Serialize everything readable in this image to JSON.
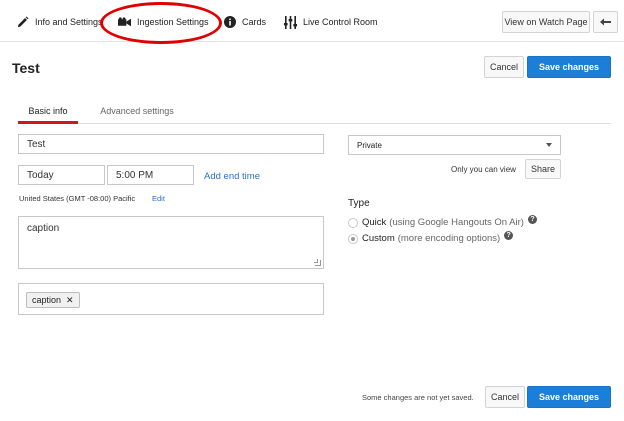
{
  "nav": {
    "items": [
      {
        "label": "Info and Settings",
        "icon": "pencil-icon"
      },
      {
        "label": "Ingestion Settings",
        "icon": "video-camera-icon"
      },
      {
        "label": "Cards",
        "icon": "info-icon"
      },
      {
        "label": "Live Control Room",
        "icon": "sliders-icon"
      }
    ],
    "view_on_watch_page": "View on Watch Page",
    "back_icon": "back-arrow-icon",
    "annotation_color": "#e00000"
  },
  "page": {
    "title": "Test",
    "cancel_label": "Cancel",
    "save_label": "Save changes"
  },
  "tabs": [
    {
      "label": "Basic info",
      "active": true
    },
    {
      "label": "Advanced settings",
      "active": false
    }
  ],
  "form": {
    "title_value": "Test",
    "date_value": "Today",
    "time_value": "5:00 PM",
    "add_end_time": "Add end time",
    "timezone": "United States (GMT -08:00) Pacific",
    "timezone_edit": "Edit",
    "description_value": "caption",
    "tags": [
      "caption"
    ]
  },
  "privacy": {
    "selected": "Private",
    "note": "Only you can view",
    "share_label": "Share"
  },
  "type": {
    "heading": "Type",
    "options": [
      {
        "label": "Quick",
        "detail": "(using Google Hangouts On Air)",
        "selected": false
      },
      {
        "label": "Custom",
        "detail": "(more encoding options)",
        "selected": true
      }
    ]
  },
  "footer": {
    "status": "Some changes are not yet saved.",
    "cancel_label": "Cancel",
    "save_label": "Save changes"
  },
  "colors": {
    "accent_blue": "#1c7ed6",
    "tab_underline": "#cc181e",
    "link": "#2a73c5"
  }
}
